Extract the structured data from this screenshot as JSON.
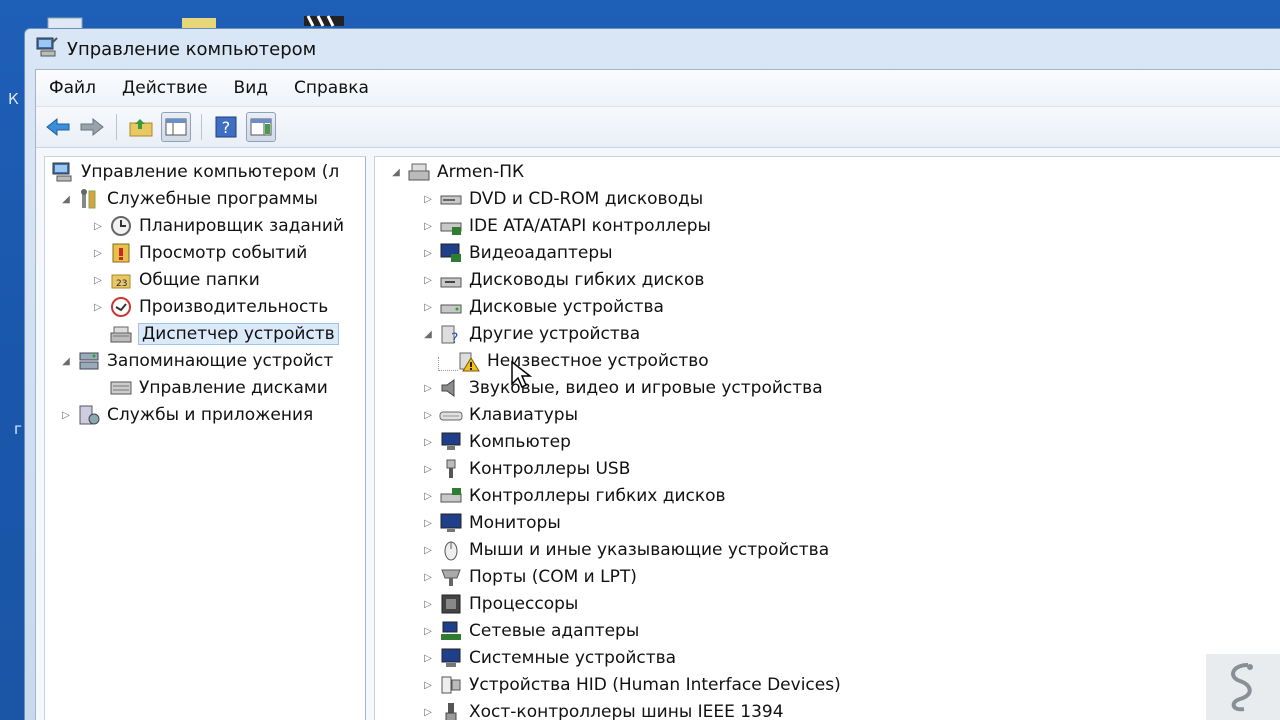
{
  "window": {
    "title": "Управление компьютером"
  },
  "menu": [
    "Файл",
    "Действие",
    "Вид",
    "Справка"
  ],
  "desktop_letters": [
    "К",
    "г"
  ],
  "left_tree": [
    {
      "label": "Управление компьютером (л",
      "icon": "computer-management-icon",
      "level": 0,
      "expander": "none"
    },
    {
      "label": "Служебные программы",
      "icon": "tools-icon",
      "level": 1,
      "expander": "expanded"
    },
    {
      "label": "Планировщик заданий",
      "icon": "clock-icon",
      "level": 2,
      "expander": "collapsed"
    },
    {
      "label": "Просмотр событий",
      "icon": "event-viewer-icon",
      "level": 2,
      "expander": "collapsed"
    },
    {
      "label": "Общие папки",
      "icon": "shared-folder-icon",
      "level": 2,
      "expander": "collapsed"
    },
    {
      "label": "Производительность",
      "icon": "performance-icon",
      "level": 2,
      "expander": "collapsed"
    },
    {
      "label": "Диспетчер устройств",
      "icon": "device-manager-icon",
      "level": 2,
      "expander": "none",
      "selected": true
    },
    {
      "label": "Запоминающие устройст",
      "icon": "storage-icon",
      "level": 1,
      "expander": "expanded"
    },
    {
      "label": "Управление дисками",
      "icon": "disk-management-icon",
      "level": 2,
      "expander": "none"
    },
    {
      "label": "Службы и приложения",
      "icon": "services-icon",
      "level": 1,
      "expander": "collapsed"
    }
  ],
  "device_tree": {
    "root": "Armen-ПК",
    "items": [
      {
        "label": "DVD и CD-ROM дисководы",
        "icon": "dvd-drive-icon",
        "expander": "collapsed"
      },
      {
        "label": "IDE ATA/ATAPI контроллеры",
        "icon": "ide-controller-icon",
        "expander": "collapsed"
      },
      {
        "label": "Видеоадаптеры",
        "icon": "display-adapter-icon",
        "expander": "collapsed"
      },
      {
        "label": "Дисководы гибких дисков",
        "icon": "floppy-drive-icon",
        "expander": "collapsed"
      },
      {
        "label": "Дисковые устройства",
        "icon": "disk-drive-icon",
        "expander": "collapsed"
      },
      {
        "label": "Другие устройства",
        "icon": "other-devices-icon",
        "expander": "expanded"
      },
      {
        "label": "Неизвестное устройство",
        "icon": "unknown-device-warning-icon",
        "expander": "none",
        "child": true
      },
      {
        "label": "Звуковые, видео и игровые устройства",
        "icon": "speaker-icon",
        "expander": "collapsed"
      },
      {
        "label": "Клавиатуры",
        "icon": "keyboard-icon",
        "expander": "collapsed"
      },
      {
        "label": "Компьютер",
        "icon": "computer-icon",
        "expander": "collapsed"
      },
      {
        "label": "Контроллеры USB",
        "icon": "usb-icon",
        "expander": "collapsed"
      },
      {
        "label": "Контроллеры гибких дисков",
        "icon": "floppy-controller-icon",
        "expander": "collapsed"
      },
      {
        "label": "Мониторы",
        "icon": "monitor-icon",
        "expander": "collapsed"
      },
      {
        "label": "Мыши и иные указывающие устройства",
        "icon": "mouse-icon",
        "expander": "collapsed"
      },
      {
        "label": "Порты (COM и LPT)",
        "icon": "port-icon",
        "expander": "collapsed"
      },
      {
        "label": "Процессоры",
        "icon": "processor-icon",
        "expander": "collapsed"
      },
      {
        "label": "Сетевые адаптеры",
        "icon": "network-adapter-icon",
        "expander": "collapsed"
      },
      {
        "label": "Системные устройства",
        "icon": "system-devices-icon",
        "expander": "collapsed"
      },
      {
        "label": "Устройства HID (Human Interface Devices)",
        "icon": "hid-icon",
        "expander": "collapsed"
      },
      {
        "label": "Хост-контроллеры шины IEEE 1394",
        "icon": "ieee1394-icon",
        "expander": "collapsed"
      }
    ]
  }
}
